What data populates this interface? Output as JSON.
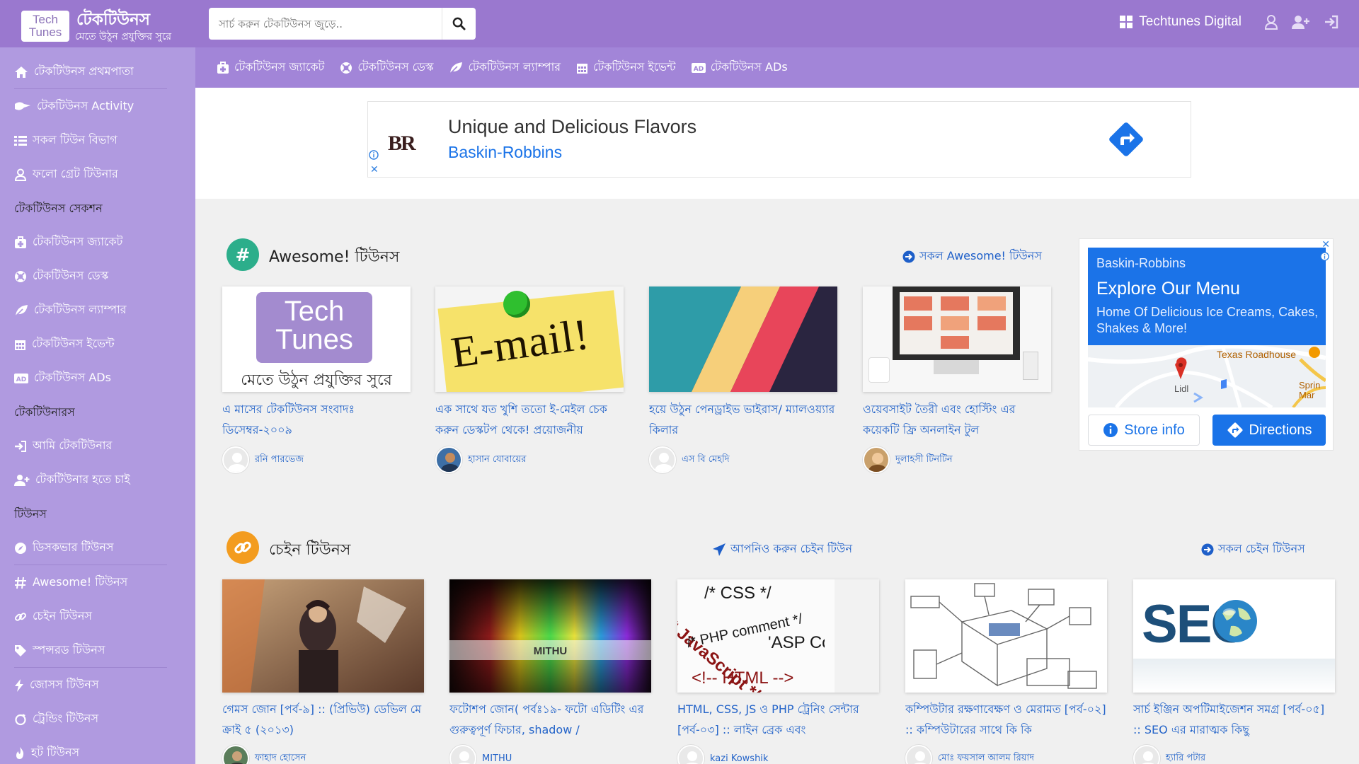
{
  "header": {
    "logo_line1": "Tech",
    "logo_line2": "Tunes",
    "brand_title": "টেকটিউনস",
    "brand_subtitle": "মেতে উঠুন প্রযুক্তির সুরে",
    "search_placeholder": "সার্চ করুন টেকটিউনস জুড়ে..",
    "digital_label": "Techtunes Digital"
  },
  "sidebar": {
    "items": [
      {
        "label": "টেকটিউনস প্রথমপাতা",
        "icon": "home-icon"
      },
      {
        "label": "টেকটিউনস Activity",
        "icon": "activity-icon"
      },
      {
        "label": "সকল টিউন বিভাগ",
        "icon": "list-icon"
      },
      {
        "label": "ফলো গ্রেট টিউনার",
        "icon": "user-icon"
      },
      {
        "label": "টেকটিউনস জ্যাকেট",
        "icon": "jacket-icon"
      },
      {
        "label": "টেকটিউনস ডেস্ক",
        "icon": "desk-icon"
      },
      {
        "label": "টেকটিউনস ল্যাম্পার",
        "icon": "leaf-icon"
      },
      {
        "label": "টেকটিউনস ইভেন্ট",
        "icon": "calendar-icon"
      },
      {
        "label": "টেকটিউনস ADs",
        "icon": "ad-icon"
      },
      {
        "label": "আমি টেকটিউনার",
        "icon": "sign-in-icon"
      },
      {
        "label": "টেকটিউনার হতে চাই",
        "icon": "user-plus-icon"
      },
      {
        "label": "ডিসকভার টিউনস",
        "icon": "compass-icon"
      },
      {
        "label": "Awesome! টিউনস",
        "icon": "hashtag-icon"
      },
      {
        "label": "চেইন টিউনস",
        "icon": "link-icon"
      },
      {
        "label": "স্পন্সরড টিউনস",
        "icon": "tag-icon"
      },
      {
        "label": "জোসস টিউনস",
        "icon": "bolt-icon"
      },
      {
        "label": "ট্রেন্ডিং টিউনস",
        "icon": "trending-icon"
      },
      {
        "label": "হট টিউনস",
        "icon": "fire-icon"
      }
    ],
    "headings": [
      "টেকটিউনস সেকশন",
      "টেকটিউনারস",
      "টিউনস"
    ]
  },
  "subnav": {
    "items": [
      {
        "label": "টেকটিউনস জ্যাকেট",
        "icon": "jacket-icon"
      },
      {
        "label": "টেকটিউনস ডেস্ক",
        "icon": "desk-icon"
      },
      {
        "label": "টেকটিউনস ল্যাম্পার",
        "icon": "leaf-icon"
      },
      {
        "label": "টেকটিউনস ইভেন্ট",
        "icon": "calendar-icon"
      },
      {
        "label": "টেকটিউনস ADs",
        "icon": "ad-icon"
      }
    ]
  },
  "top_ad": {
    "logo_text": "BR",
    "title": "Unique and Delicious Flavors",
    "brand": "Baskin-Robbins"
  },
  "awesome": {
    "title": "Awesome! টিউনস",
    "all_link": "সকল Awesome! টিউনস",
    "cards": [
      {
        "title": "এ মাসের টেকটিউনস সংবাদঃ ডিসেম্বর-২০০৯",
        "author": "রনি পারভেজ",
        "thumb_text_1": "Tech",
        "thumb_text_2": "Tunes",
        "thumb_text_3": "মেতে উঠুন প্রযুক্তির সুরে"
      },
      {
        "title": "এক সাথে যত খুশি ততো ই-মেইল চেক করুন ডেস্কটপ থেকে! প্রয়োজনীয়",
        "author": "হাসান যোবায়ের",
        "thumb_text_1": "E-mail!"
      },
      {
        "title": "হয়ে উঠুন পেনড্রাইভ ভাইরাস/ ম্যালওয়্যার কিলার",
        "author": "এস বি মেহদি"
      },
      {
        "title": "ওয়েবসাইট তৈরী এবং হোস্টিং এর কয়েকটি ফ্রি অনলাইন টুল",
        "author": "দুলাহসী টিনটিন"
      }
    ]
  },
  "chain": {
    "title": "চেইন টিউনস",
    "contribute_link": "আপনিও করুন চেইন টিউন",
    "all_link": "সকল চেইন টিউনস",
    "cards": [
      {
        "title": "গেমস জোন [পর্ব-৯] :: (প্রিভিউ) ডেভিল মে ক্রাই ৫ (২০১৩)",
        "author": "ফাহাদ হোসেন"
      },
      {
        "title": "ফটোশপ জোন( পর্বঃ১৯- ফটো এডিটিং এর গুরুত্বপূর্ণ ফিচার, shadow /",
        "author": "MITHU",
        "thumb_text_1": "MITHU"
      },
      {
        "title": "HTML, CSS, JS ও PHP ট্রেনিং সেন্টার [পর্ব-০৩] :: লাইন ব্রেক এবং",
        "author": "kazi Kowshik",
        "thumb_text_1": "/* CSS */",
        "thumb_text_2": "/* JavaScript */",
        "thumb_text_3": "/* PHP comment */",
        "thumb_text_4": "'ASP Co",
        "thumb_text_5": "<!-- HTML -->"
      },
      {
        "title": "কম্পিউটার রক্ষণাবেক্ষণ ও মেরামত [পর্ব-০২] :: কম্পিউটারের সাথে কি কি",
        "author": "মোঃ ফয়সাল আলম রিয়াদ"
      },
      {
        "title": "সার্চ ইঞ্জিন অপটিমাইজেশন সমগ্র [পর্ব-০৫] :: SEO এর মারাত্মক কিছু",
        "author": "হ্যারি পটার",
        "thumb_text_1": "SEO"
      }
    ]
  },
  "side_ad": {
    "brand": "Baskin-Robbins",
    "headline": "Explore Our Menu",
    "subtext": "Home Of Delicious Ice Creams, Cakes, Shakes & More!",
    "map_label_1": "Texas Roadhouse",
    "map_label_2": "Lidl",
    "map_label_3": "Sprin Mar",
    "store_info": "Store info",
    "directions": "Directions"
  },
  "colors": {
    "header": "#9a78cf",
    "sidebar": "#b09ae0",
    "subnav": "#a285d8",
    "link": "#2464c9",
    "ad_blue": "#1b73e8",
    "awesome_icon": "#2cae8b",
    "chain_icon": "#f39c1f"
  }
}
